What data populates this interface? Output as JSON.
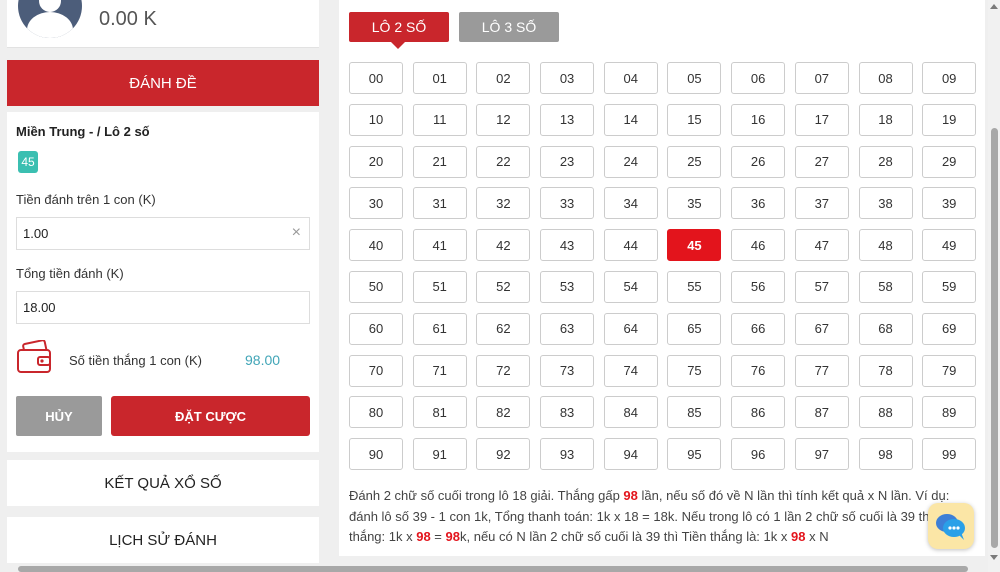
{
  "profile": {
    "balance": "0.00 K"
  },
  "danh_de_button": "ĐÁNH ĐỀ",
  "bet_panel": {
    "title": "Miền Trung - / Lô 2 số",
    "selected_chip": "45",
    "amount_label": "Tiền đánh trên 1 con (K)",
    "amount_value": "1.00",
    "clear_icon": "×",
    "total_label": "Tổng tiền đánh (K)",
    "total_value": "18.00",
    "win_label": "Số tiền thắng 1 con (K)",
    "win_value": "98.00",
    "cancel_label": "HỦY",
    "submit_label": "ĐẶT CƯỢC"
  },
  "menu": {
    "results": "KẾT QUẢ XỔ SỐ",
    "history": "LỊCH SỬ ĐÁNH"
  },
  "tabs": [
    {
      "label": "LÔ 2 SỐ",
      "active": true
    },
    {
      "label": "LÔ 3 SỐ",
      "active": false
    }
  ],
  "numbers": [
    "00",
    "01",
    "02",
    "03",
    "04",
    "05",
    "06",
    "07",
    "08",
    "09",
    "10",
    "11",
    "12",
    "13",
    "14",
    "15",
    "16",
    "17",
    "18",
    "19",
    "20",
    "21",
    "22",
    "23",
    "24",
    "25",
    "26",
    "27",
    "28",
    "29",
    "30",
    "31",
    "32",
    "33",
    "34",
    "35",
    "36",
    "37",
    "38",
    "39",
    "40",
    "41",
    "42",
    "43",
    "44",
    "45",
    "46",
    "47",
    "48",
    "49",
    "50",
    "51",
    "52",
    "53",
    "54",
    "55",
    "56",
    "57",
    "58",
    "59",
    "60",
    "61",
    "62",
    "63",
    "64",
    "65",
    "66",
    "67",
    "68",
    "69",
    "70",
    "71",
    "72",
    "73",
    "74",
    "75",
    "76",
    "77",
    "78",
    "79",
    "80",
    "81",
    "82",
    "83",
    "84",
    "85",
    "86",
    "87",
    "88",
    "89",
    "90",
    "91",
    "92",
    "93",
    "94",
    "95",
    "96",
    "97",
    "98",
    "99"
  ],
  "selected_number": "45",
  "description": {
    "p1": "Đánh 2 chữ số cuối trong lô 18 giải. Thắng gấp ",
    "rate1": "98",
    "p2": " lần, nếu số đó về N lần thì tính kết quả x N lần. Ví dụ: đánh lô số 39 - 1 con 1k, Tổng thanh toán: 1k x 18 = 18k. Nếu trong lô có 1 lần 2 chữ số cuối là 39 thì Tiền thắng: 1k x ",
    "rate2": "98",
    "p3": " = ",
    "rate3": "98",
    "p4": "k, nếu có N lần 2 chữ số cuối là 39 thì Tiền thắng là: 1k x ",
    "rate4": "98",
    "p5": " x N"
  },
  "colors": {
    "primary_red": "#c9262c",
    "selected_red": "#e3141c",
    "grey": "#9a9a9a",
    "teal": "#3bbfb1",
    "win_blue": "#41a5b7"
  },
  "icons": {
    "avatar": "user-avatar-icon",
    "wallet": "wallet-icon",
    "chat": "chat-bubble-icon"
  }
}
